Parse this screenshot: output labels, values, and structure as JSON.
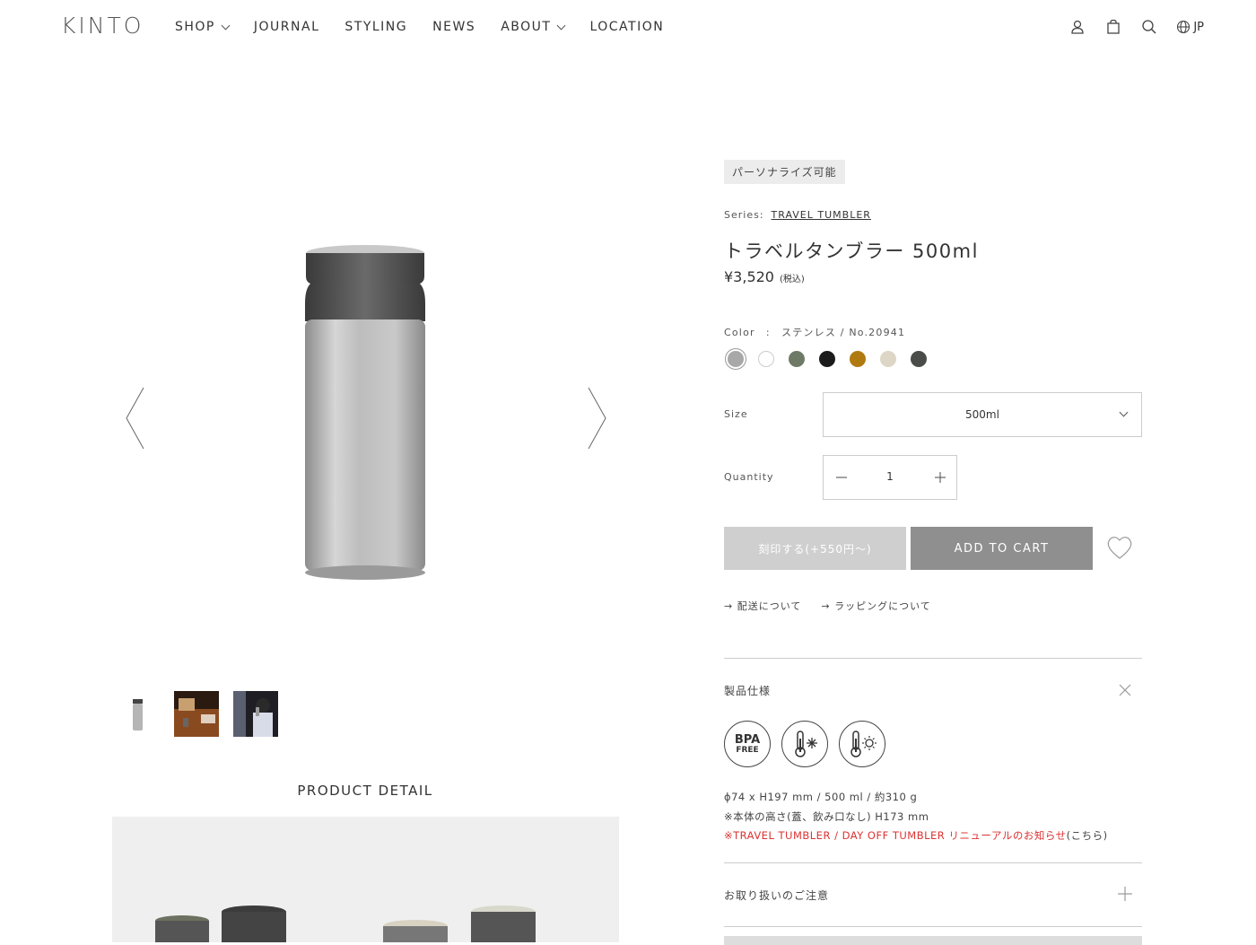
{
  "header": {
    "logo": "KINTO",
    "nav": [
      {
        "label": "SHOP",
        "has_dropdown": true
      },
      {
        "label": "JOURNAL",
        "has_dropdown": false
      },
      {
        "label": "STYLING",
        "has_dropdown": false
      },
      {
        "label": "NEWS",
        "has_dropdown": false
      },
      {
        "label": "ABOUT",
        "has_dropdown": true
      },
      {
        "label": "LOCATION",
        "has_dropdown": false
      }
    ],
    "icons": [
      "account-icon",
      "cart-icon",
      "search-icon",
      "globe-icon"
    ],
    "language": "JP"
  },
  "gallery": {
    "thumbnails": [
      "tumbler-thumb",
      "cafe-scene-thumb",
      "person-drinking-thumb"
    ],
    "product_detail_title": "PRODUCT DETAIL"
  },
  "product": {
    "tag": "パーソナライズ可能",
    "series_label": "Series:",
    "series_name": "TRAVEL TUMBLER",
    "title": "トラベルタンブラー 500ml",
    "price": "¥3,520",
    "tax_note": "(税込)",
    "color_label": "Color　:　ステンレス / No.20941",
    "colors": [
      "#a8a8a8",
      "#ffffff",
      "#6e7a66",
      "#1b1b1b",
      "#b07a10",
      "#ddd6c6",
      "#4a4c4a"
    ],
    "selected_color_index": 0,
    "size_label": "Size",
    "size_value": "500ml",
    "quantity_label": "Quantity",
    "quantity_value": "1",
    "engrave_button": "刻印する(+550円〜)",
    "add_to_cart": "ADD TO CART",
    "link_shipping": "配送について",
    "link_wrapping": "ラッピングについて"
  },
  "specs": {
    "header": "製品仕様",
    "badges": [
      {
        "name": "bpa-free-icon",
        "line1": "BPA",
        "line2": "FREE"
      },
      {
        "name": "cold-thermometer-icon"
      },
      {
        "name": "hot-thermometer-icon"
      }
    ],
    "line1": "ϕ74 x H197 mm / 500 ml / 約310 g",
    "line2": "※本体の高さ(蓋、飲み口なし) H173 mm",
    "line3_red": "※TRAVEL TUMBLER / DAY OFF TUMBLER リニューアルのお知らせ",
    "line3_link": "(こちら)"
  },
  "care": {
    "header": "お取り扱いのご注意"
  }
}
